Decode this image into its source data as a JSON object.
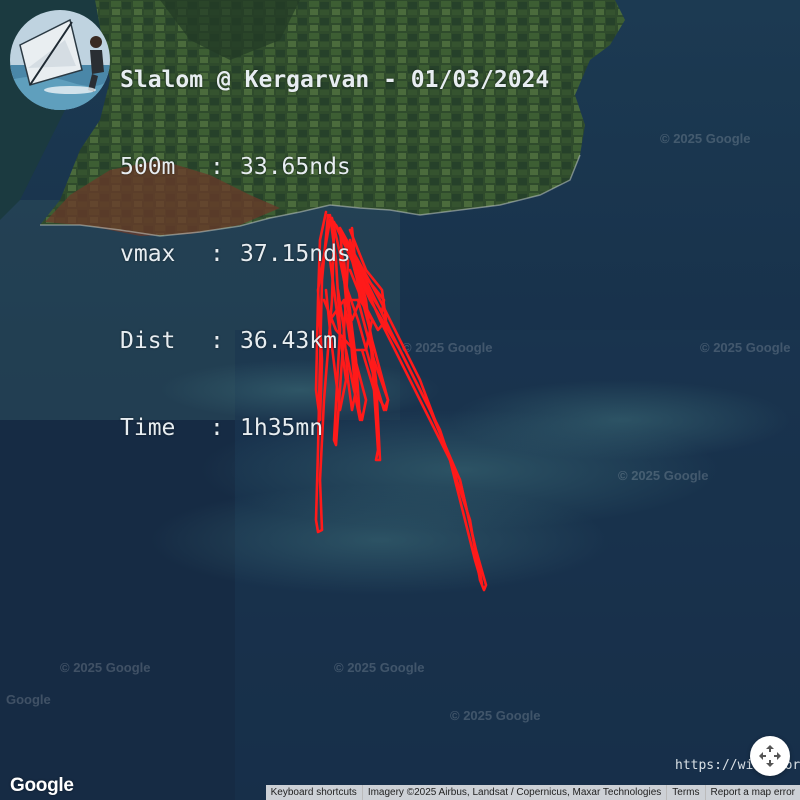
{
  "session": {
    "title": "Slalom @ Kergarvan - 01/03/2024",
    "stats": [
      {
        "key": "500m",
        "sep": ":",
        "value": "33.65nds"
      },
      {
        "key": "vmax",
        "sep": ":",
        "value": "37.15nds"
      },
      {
        "key": "Dist",
        "sep": ":",
        "value": "36.43km"
      },
      {
        "key": "Time",
        "sep": ":",
        "value": "1h35mn"
      }
    ]
  },
  "map": {
    "watermarks": [
      "© 2025 Google",
      "© 2025 Google",
      "© 2025 Google",
      "© 2025 Google",
      "© 2025 Google",
      "© 2025 Google",
      "© 2025 Google",
      "Google"
    ],
    "logo": "Google",
    "site_url": "https://windo.org",
    "attribution": {
      "keyboard_shortcuts": "Keyboard shortcuts",
      "imagery": "Imagery ©2025 Airbus, Landsat / Copernicus, Maxar Technologies",
      "terms": "Terms",
      "report": "Report a map error"
    },
    "icons": {
      "fullscreen": "fullscreen-arrows-icon",
      "avatar": "windsurfer-avatar"
    },
    "colors": {
      "track": "#ff1a1a",
      "sea_deep": "#152a44",
      "sea_shallow": "#2d5a6e",
      "land": "#2f4a2c"
    }
  }
}
